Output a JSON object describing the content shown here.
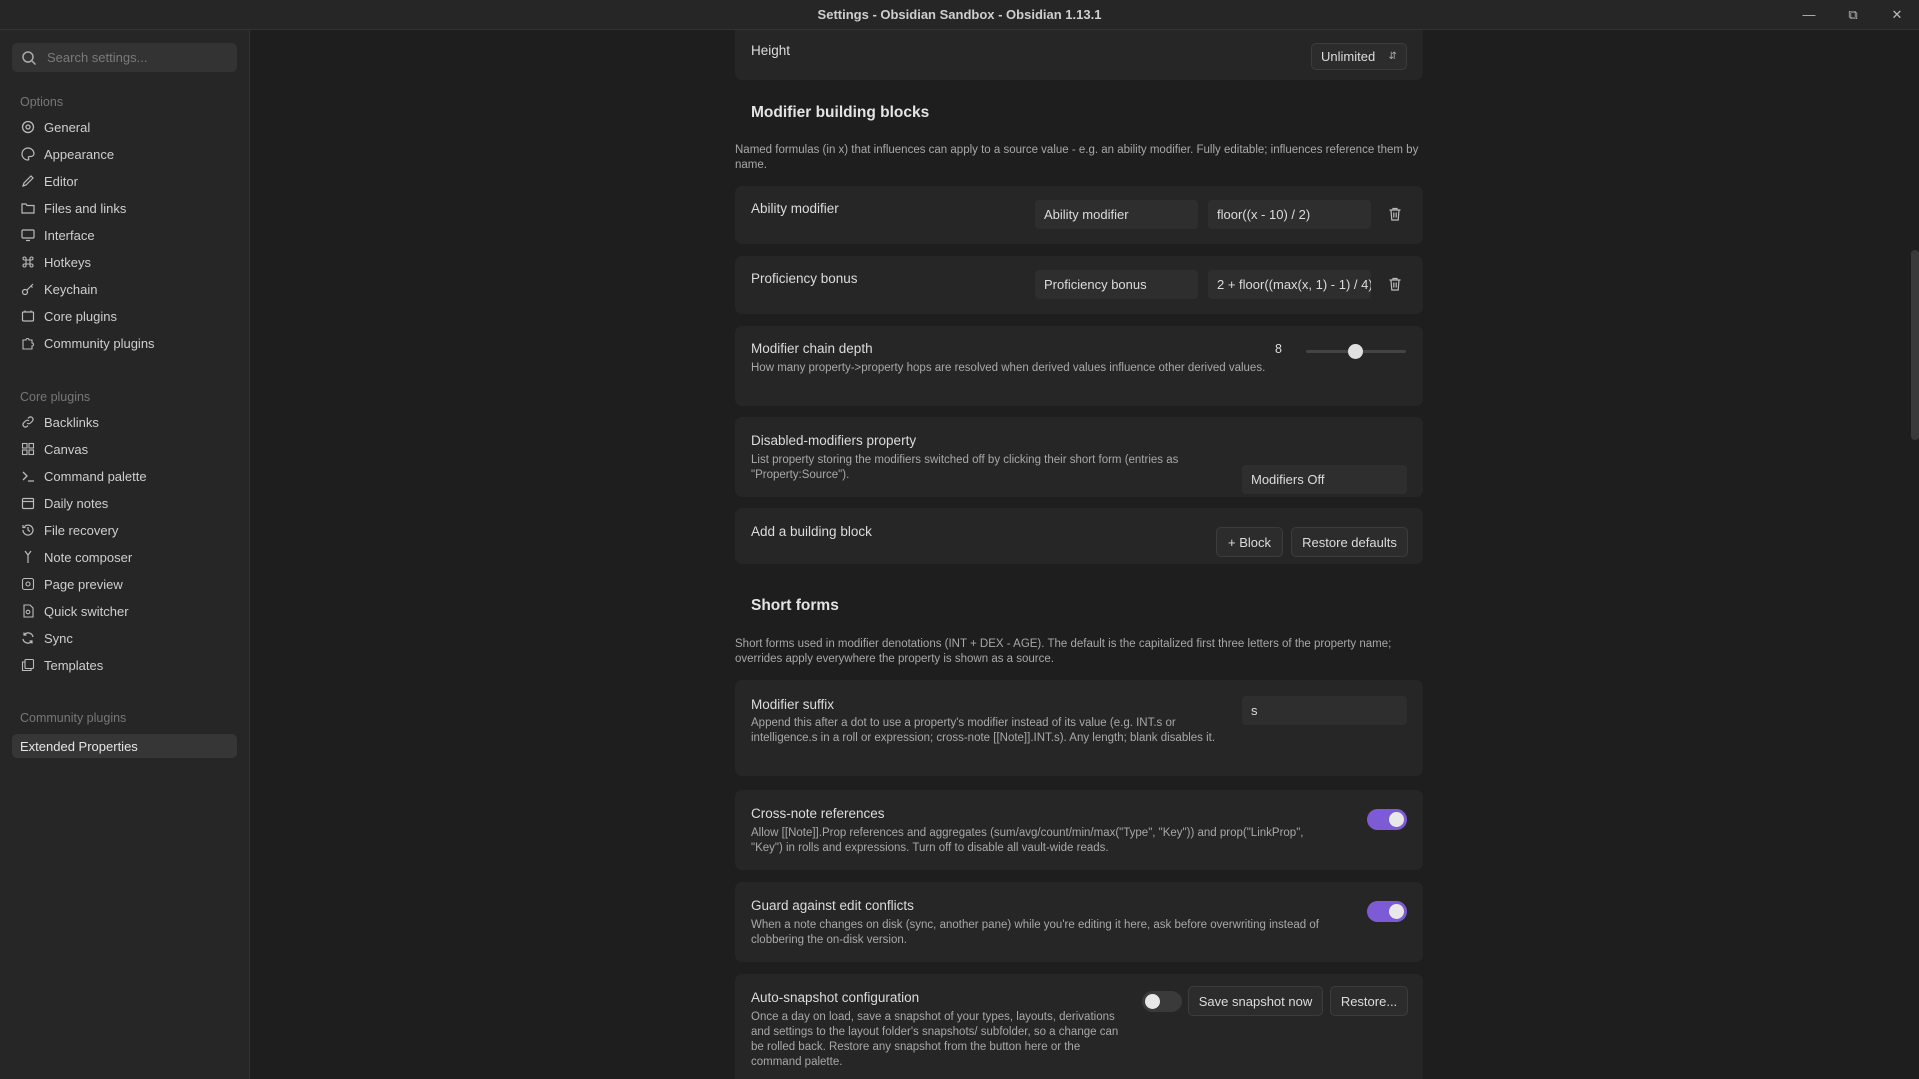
{
  "window": {
    "title": "Settings - Obsidian Sandbox - Obsidian 1.13.1"
  },
  "sidebar": {
    "search_placeholder": "Search settings...",
    "options_title": "Options",
    "options": [
      {
        "label": "General",
        "icon": "gear-icon"
      },
      {
        "label": "Appearance",
        "icon": "palette-icon"
      },
      {
        "label": "Editor",
        "icon": "pencil-icon"
      },
      {
        "label": "Files and links",
        "icon": "folder-link-icon"
      },
      {
        "label": "Interface",
        "icon": "monitor-icon"
      },
      {
        "label": "Hotkeys",
        "icon": "command-icon"
      },
      {
        "label": "Keychain",
        "icon": "key-icon"
      },
      {
        "label": "Core plugins",
        "icon": "plugin-icon"
      },
      {
        "label": "Community plugins",
        "icon": "puzzle-icon"
      }
    ],
    "core_title": "Core plugins",
    "core": [
      {
        "label": "Backlinks",
        "icon": "link-icon"
      },
      {
        "label": "Canvas",
        "icon": "grid-icon"
      },
      {
        "label": "Command palette",
        "icon": "terminal-icon"
      },
      {
        "label": "Daily notes",
        "icon": "calendar-icon"
      },
      {
        "label": "File recovery",
        "icon": "history-icon"
      },
      {
        "label": "Note composer",
        "icon": "merge-icon"
      },
      {
        "label": "Page preview",
        "icon": "eye-icon"
      },
      {
        "label": "Quick switcher",
        "icon": "file-search-icon"
      },
      {
        "label": "Sync",
        "icon": "sync-icon"
      },
      {
        "label": "Templates",
        "icon": "template-icon"
      }
    ],
    "community_title": "Community plugins",
    "community": [
      {
        "label": "Extended Properties",
        "active": true
      }
    ]
  },
  "main": {
    "height": {
      "name": "Height",
      "value": "Unlimited"
    },
    "modifier_blocks": {
      "title": "Modifier building blocks",
      "description": "Named formulas (in x) that influences can apply to a source value - e.g. an ability modifier. Fully editable; influences reference them by name.",
      "blocks": [
        {
          "name": "Ability modifier",
          "label_value": "Ability modifier",
          "formula_value": "floor((x - 10) / 2)"
        },
        {
          "name": "Proficiency bonus",
          "label_value": "Proficiency bonus",
          "formula_value": "2 + floor((max(x, 1) - 1) / 4)"
        }
      ],
      "chain_depth": {
        "name": "Modifier chain depth",
        "description": "How many property->property hops are resolved when derived values influence other derived values.",
        "value": "8",
        "slider_fraction": 0.5
      },
      "disabled_property": {
        "name": "Disabled-modifiers property",
        "description": "List property storing the modifiers switched off by clicking their short form (entries as \"Property:Source\").",
        "value": "Modifiers Off"
      },
      "add_block": {
        "name": "Add a building block",
        "add_label": "+ Block",
        "restore_label": "Restore defaults"
      }
    },
    "short_forms": {
      "title": "Short forms",
      "description": "Short forms used in modifier denotations (INT + DEX - AGE). The default is the capitalized first three letters of the property name; overrides apply everywhere the property is shown as a source.",
      "suffix": {
        "name": "Modifier suffix",
        "description": "Append this after a dot to use a property's modifier instead of its value (e.g. INT.s or intelligence.s in a roll or expression; cross-note [[Note]].INT.s). Any length; blank disables it.",
        "value": "s"
      },
      "cross_note": {
        "name": "Cross-note references",
        "description": "Allow [[Note]].Prop references and aggregates (sum/avg/count/min/max(\"Type\", \"Key\")) and prop(\"LinkProp\", \"Key\") in rolls and expressions. Turn off to disable all vault-wide reads.",
        "enabled": true
      },
      "guard": {
        "name": "Guard against edit conflicts",
        "description": "When a note changes on disk (sync, another pane) while you're editing it here, ask before overwriting instead of clobbering the on-disk version.",
        "enabled": true
      },
      "snapshot": {
        "name": "Auto-snapshot configuration",
        "description": "Once a day on load, save a snapshot of your types, layouts, derivations and settings to the layout folder's snapshots/ subfolder, so a change can be rolled back. Restore any snapshot from the button here or the command palette.",
        "enabled": false,
        "save_label": "Save snapshot now",
        "restore_label": "Restore..."
      }
    }
  },
  "colors": {
    "accent": "#7e5bd6",
    "background": "#1e1e1e",
    "sidebar": "#262626"
  }
}
